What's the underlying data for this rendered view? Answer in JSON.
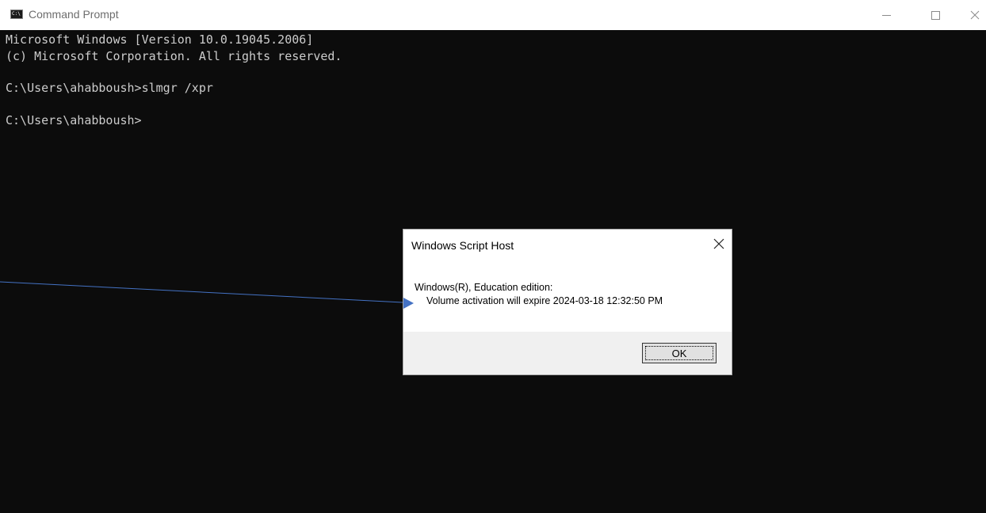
{
  "window": {
    "title": "Command Prompt",
    "icon_text": "C:\\"
  },
  "console": {
    "lines": [
      "Microsoft Windows [Version 10.0.19045.2006]",
      "(c) Microsoft Corporation. All rights reserved.",
      "C:\\Users\\ahabboush>slmgr /xpr",
      "C:\\Users\\ahabboush>"
    ]
  },
  "dialog": {
    "title": "Windows Script Host",
    "message_line1": "Windows(R), Education edition:",
    "message_line2": "Volume activation will expire 2024-03-18 12:32:50 PM",
    "ok_label": "OK"
  },
  "colors": {
    "console_bg": "#0c0c0c",
    "console_text": "#cccccc",
    "annotation_arrow": "#4472c4"
  },
  "icons": {
    "close": "close-icon",
    "minimize": "minimize-icon",
    "maximize": "maximize-icon",
    "app": "command-prompt-icon"
  }
}
